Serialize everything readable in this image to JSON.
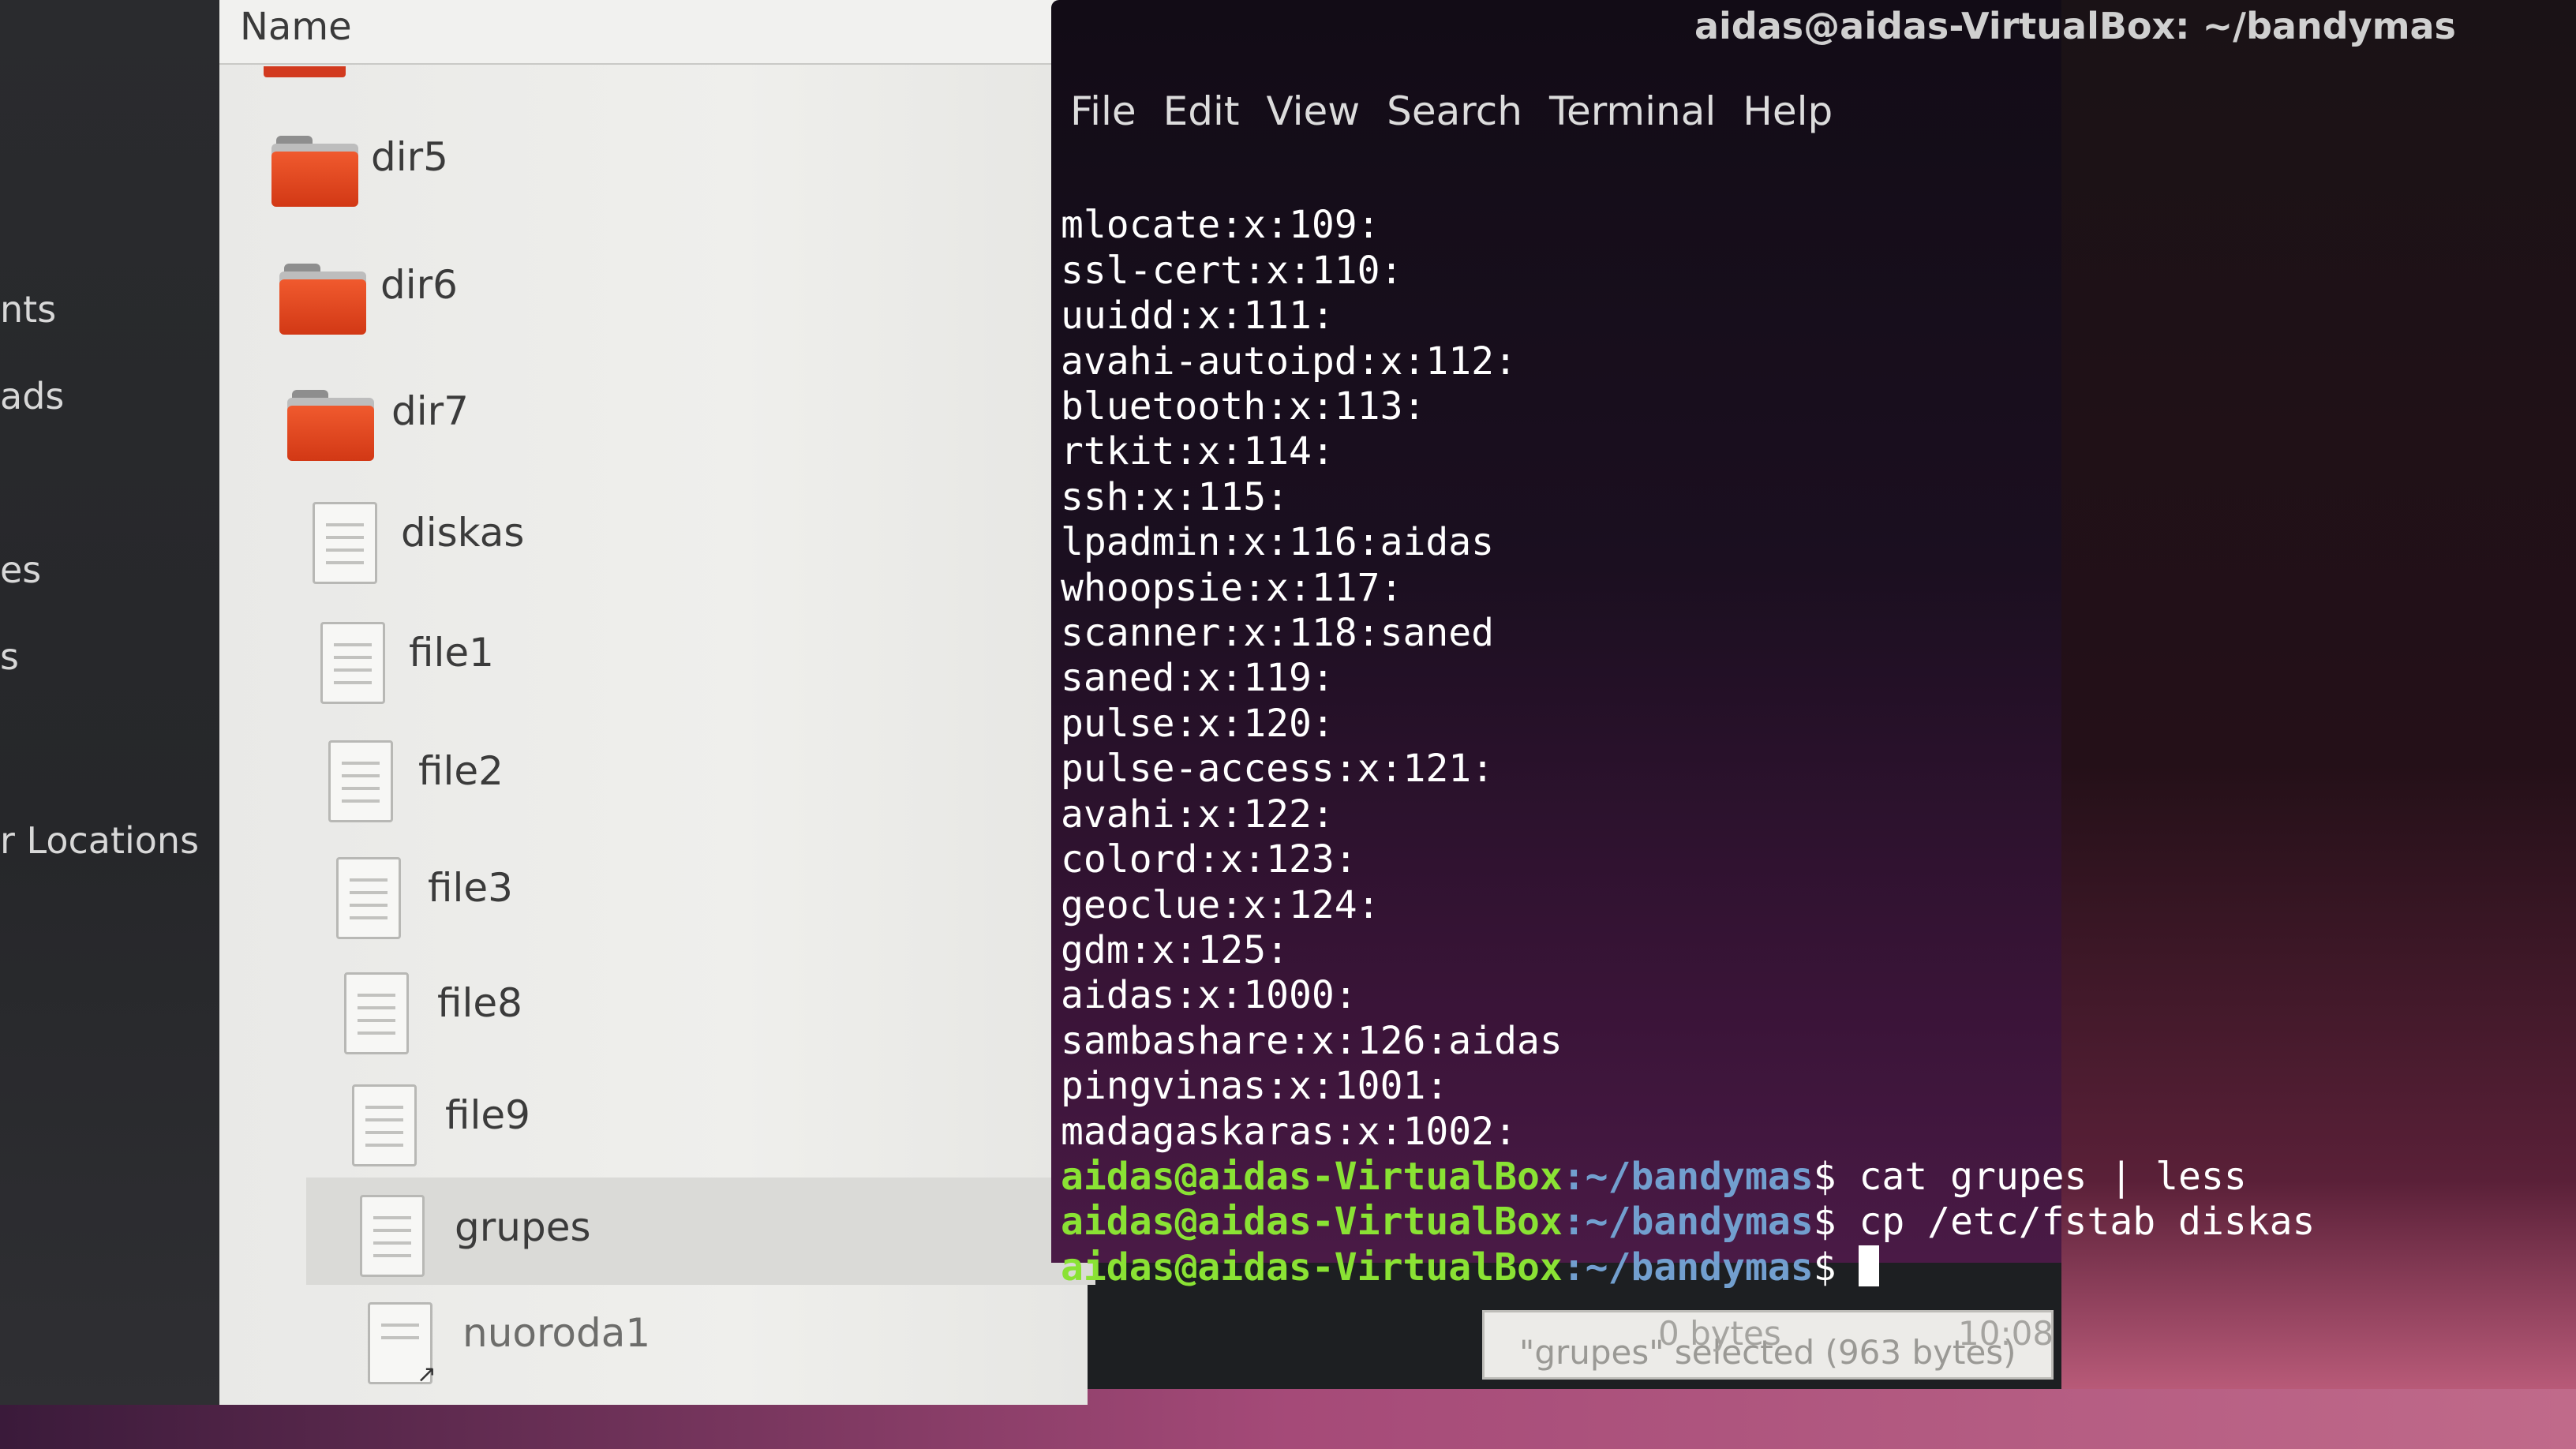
{
  "sidebar": {
    "items": [
      "nts",
      "ads",
      "es",
      "s",
      "r Locations"
    ]
  },
  "file_manager": {
    "column_header": "Name",
    "files": [
      {
        "name": "dir5",
        "type": "folder"
      },
      {
        "name": "dir6",
        "type": "folder"
      },
      {
        "name": "dir7",
        "type": "folder"
      },
      {
        "name": "diskas",
        "type": "file"
      },
      {
        "name": "file1",
        "type": "file"
      },
      {
        "name": "file2",
        "type": "file"
      },
      {
        "name": "file3",
        "type": "file"
      },
      {
        "name": "file8",
        "type": "file"
      },
      {
        "name": "file9",
        "type": "file"
      },
      {
        "name": "grupes",
        "type": "file",
        "selected": true
      },
      {
        "name": "nuoroda1",
        "type": "link"
      }
    ],
    "status": {
      "selection": "\"grupes\" selected (963 bytes)",
      "size": "0 bytes",
      "time": "10:08"
    }
  },
  "terminal": {
    "title": "aidas@aidas-VirtualBox: ~/bandymas",
    "menu": [
      "File",
      "Edit",
      "View",
      "Search",
      "Terminal",
      "Help"
    ],
    "output_lines": [
      "mlocate:x:109:",
      "ssl-cert:x:110:",
      "uuidd:x:111:",
      "avahi-autoipd:x:112:",
      "bluetooth:x:113:",
      "rtkit:x:114:",
      "ssh:x:115:",
      "lpadmin:x:116:aidas",
      "whoopsie:x:117:",
      "scanner:x:118:saned",
      "saned:x:119:",
      "pulse:x:120:",
      "pulse-access:x:121:",
      "avahi:x:122:",
      "colord:x:123:",
      "geoclue:x:124:",
      "gdm:x:125:",
      "aidas:x:1000:",
      "sambashare:x:126:aidas",
      "pingvinas:x:1001:",
      "madagaskaras:x:1002:"
    ],
    "prompt_user": "aidas@aidas-VirtualBox",
    "prompt_path": ":~/bandymas",
    "prompt_symbol": "$",
    "commands": [
      "cat grupes | less",
      "cp /etc/fstab diskas",
      ""
    ]
  },
  "colors": {
    "prompt_user": "#8ae234",
    "prompt_path": "#729fcf",
    "folder": "#e8492a"
  }
}
